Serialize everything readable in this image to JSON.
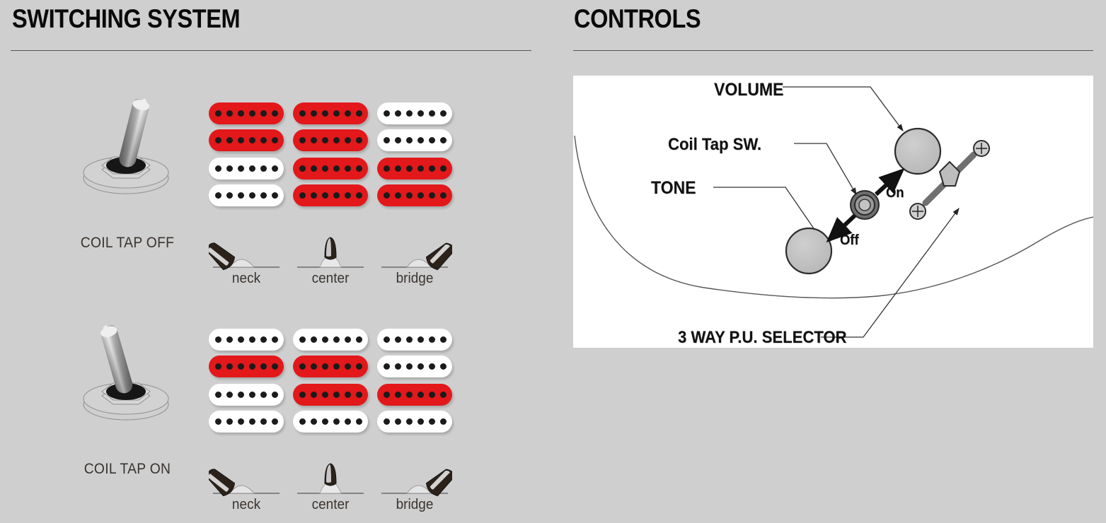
{
  "sections": {
    "switching": {
      "title": "SWITCHING SYSTEM"
    },
    "controls": {
      "title": "CONTROLS"
    }
  },
  "colors": {
    "background": "#cfcfcf",
    "active_coil": "#e2181b",
    "inactive_coil": "#ffffff",
    "pole_piece": "#1b1b1b",
    "text": "#3a3430",
    "panel": "#ffffff"
  },
  "switching_system": {
    "modes": [
      {
        "id": "coil-tap-off",
        "label": "COIL TAP OFF",
        "toggle_icon": "toggle-switch-right",
        "positions": [
          {
            "name": "neck",
            "blade_icon": "blade-switch-left",
            "neck_pickup": {
              "top_coil": "red",
              "bottom_coil": "red"
            },
            "bridge_pickup": {
              "top_coil": "white",
              "bottom_coil": "white"
            }
          },
          {
            "name": "center",
            "blade_icon": "blade-switch-center",
            "neck_pickup": {
              "top_coil": "red",
              "bottom_coil": "red"
            },
            "bridge_pickup": {
              "top_coil": "red",
              "bottom_coil": "red"
            }
          },
          {
            "name": "bridge",
            "blade_icon": "blade-switch-right",
            "neck_pickup": {
              "top_coil": "white",
              "bottom_coil": "white"
            },
            "bridge_pickup": {
              "top_coil": "red",
              "bottom_coil": "red"
            }
          }
        ]
      },
      {
        "id": "coil-tap-on",
        "label": "COIL TAP ON",
        "toggle_icon": "toggle-switch-left",
        "positions": [
          {
            "name": "neck",
            "blade_icon": "blade-switch-left",
            "neck_pickup": {
              "top_coil": "white",
              "bottom_coil": "red"
            },
            "bridge_pickup": {
              "top_coil": "white",
              "bottom_coil": "white"
            }
          },
          {
            "name": "center",
            "blade_icon": "blade-switch-center",
            "neck_pickup": {
              "top_coil": "white",
              "bottom_coil": "red"
            },
            "bridge_pickup": {
              "top_coil": "red",
              "bottom_coil": "white"
            }
          },
          {
            "name": "bridge",
            "blade_icon": "blade-switch-right",
            "neck_pickup": {
              "top_coil": "white",
              "bottom_coil": "white"
            },
            "bridge_pickup": {
              "top_coil": "red",
              "bottom_coil": "white"
            }
          }
        ]
      }
    ],
    "poles_per_coil": 6
  },
  "controls_diagram": {
    "labels": {
      "volume": "VOLUME",
      "coil_tap_sw": "Coil Tap SW.",
      "tone": "TONE",
      "selector": "3 WAY P.U. SELECTOR",
      "on": "On",
      "off": "Off"
    },
    "parts": [
      {
        "name": "volume-knob",
        "type": "knob"
      },
      {
        "name": "tone-knob",
        "type": "knob"
      },
      {
        "name": "coil-tap-switch",
        "type": "mini-toggle"
      },
      {
        "name": "pickup-selector",
        "type": "3-way-blade"
      }
    ]
  }
}
